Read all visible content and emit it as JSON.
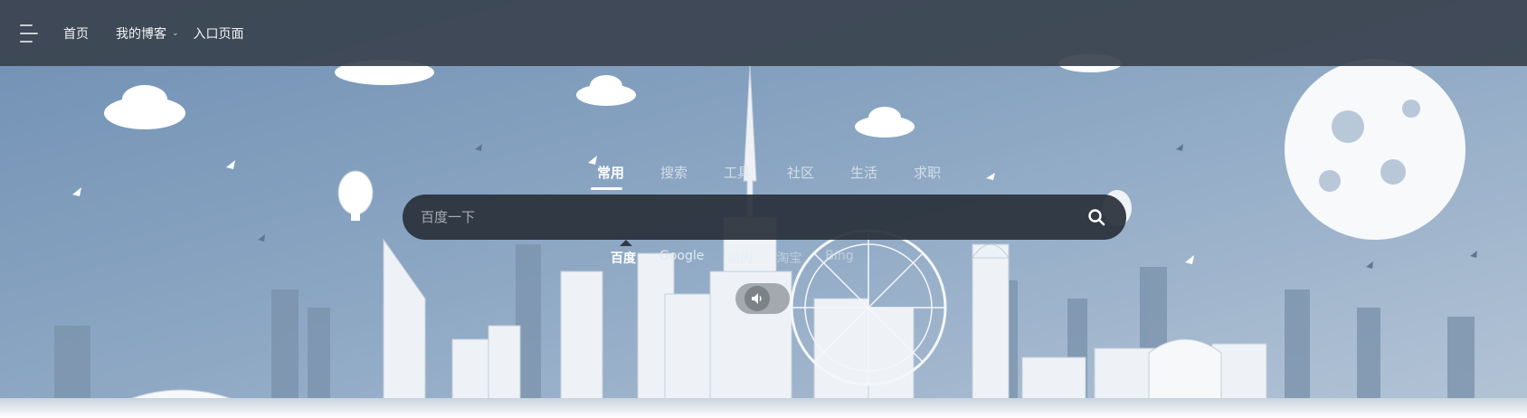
{
  "nav": {
    "items": [
      {
        "label": "首页"
      },
      {
        "label": "我的博客",
        "has_dropdown": true
      },
      {
        "label": "入口页面"
      }
    ]
  },
  "search": {
    "tabs": [
      {
        "label": "常用",
        "active": true
      },
      {
        "label": "搜索",
        "active": false
      },
      {
        "label": "工具",
        "active": false
      },
      {
        "label": "社区",
        "active": false
      },
      {
        "label": "生活",
        "active": false
      },
      {
        "label": "求职",
        "active": false
      }
    ],
    "placeholder": "百度一下",
    "engines": [
      {
        "label": "百度",
        "active": true
      },
      {
        "label": "Google",
        "active": false
      },
      {
        "label": "站内",
        "active": false
      },
      {
        "label": "淘宝",
        "active": false
      },
      {
        "label": "Bing",
        "active": false
      }
    ]
  },
  "icons": {
    "menu": "menu-icon",
    "search": "search-icon",
    "sound": "speaker-icon",
    "caret": "chevron-down-icon"
  },
  "colors": {
    "topbar": "#3a424e",
    "sky": "#8aa4bf",
    "search_bar": "#28303a"
  }
}
